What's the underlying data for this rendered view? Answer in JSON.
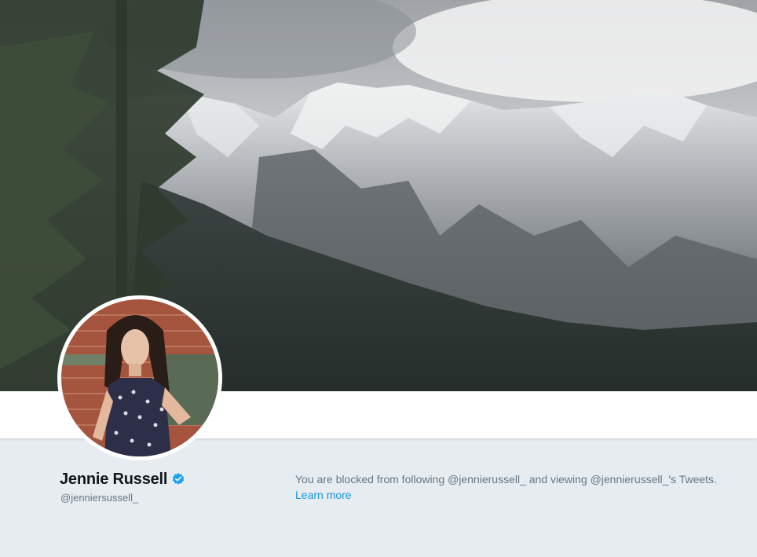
{
  "profile": {
    "name": "Jennie Russell",
    "handle": "@jenniersussell_",
    "verified": true
  },
  "blocked_notice": {
    "text": "You are blocked from following @jennierussell_ and viewing @jennierussell_'s Tweets.",
    "learn_more": "Learn more"
  },
  "colors": {
    "page_background": "#e6ecf0",
    "link": "#1b95e0",
    "verified_badge": "#1da1f2",
    "secondary_text": "#657786"
  },
  "icons": {
    "verified": "verified-badge-icon"
  }
}
